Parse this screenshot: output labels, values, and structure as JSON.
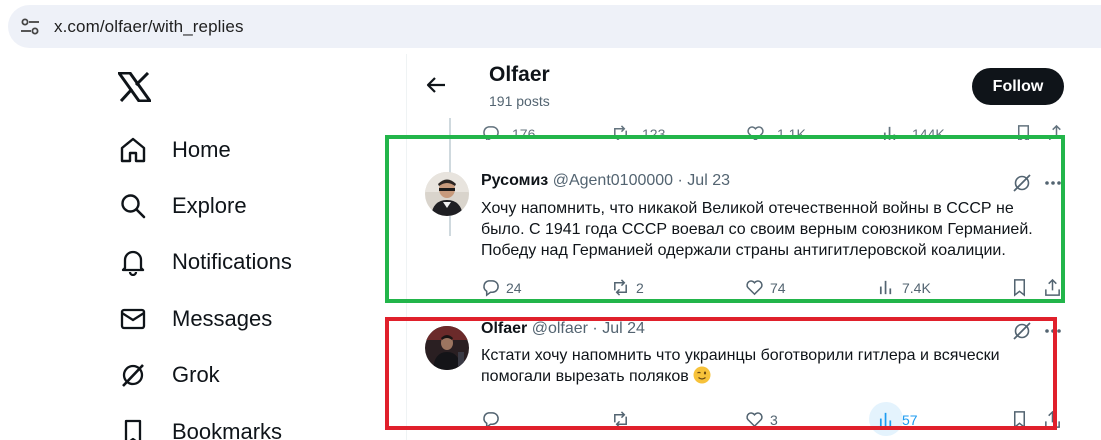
{
  "browser": {
    "url": "x.com/olfaer/with_replies",
    "tune_icon": "tune-icon"
  },
  "sidebar": {
    "logo": "x-logo",
    "items": [
      {
        "label": "Home",
        "icon": "home-icon"
      },
      {
        "label": "Explore",
        "icon": "search-icon"
      },
      {
        "label": "Notifications",
        "icon": "bell-icon"
      },
      {
        "label": "Messages",
        "icon": "envelope-icon"
      },
      {
        "label": "Grok",
        "icon": "grok-icon"
      },
      {
        "label": "Bookmarks",
        "icon": "bookmark-icon"
      }
    ]
  },
  "header": {
    "name": "Olfaer",
    "posts": "191 posts",
    "follow_label": "Follow"
  },
  "faded_actions": {
    "replies": "176",
    "reposts": "123",
    "likes": "1.1K",
    "views": "144K"
  },
  "tweets": [
    {
      "name": "Русомиз",
      "handle": "@Agent0100000",
      "sep": "·",
      "date": "Jul 23",
      "lines": [
        "Хочу напомнить, что никакой Великой отечественной войны в СССР не",
        "было. С 1941 года СССР воевал со своим верным союзником Германией.",
        "Победу над Германией одержали страны антигитлеровской коалиции."
      ],
      "replies": "24",
      "reposts": "2",
      "likes": "74",
      "views": "7.4K"
    },
    {
      "name": "Olfaer",
      "handle": "@olfaer",
      "sep": "·",
      "date": "Jul 24",
      "lines": [
        "Кстати хочу напомнить что украинцы боготворили гитлера и всячески",
        "помогали вырезать поляков"
      ],
      "emoji": "winking-face",
      "replies": "",
      "reposts": "",
      "likes": "3",
      "views": "57"
    }
  ],
  "colors": {
    "accent": "#1d9bf0",
    "green_box": "#22b54a",
    "red_box": "#e0202b",
    "follow_bg": "#0f1419",
    "secondary_text": "#536471"
  }
}
